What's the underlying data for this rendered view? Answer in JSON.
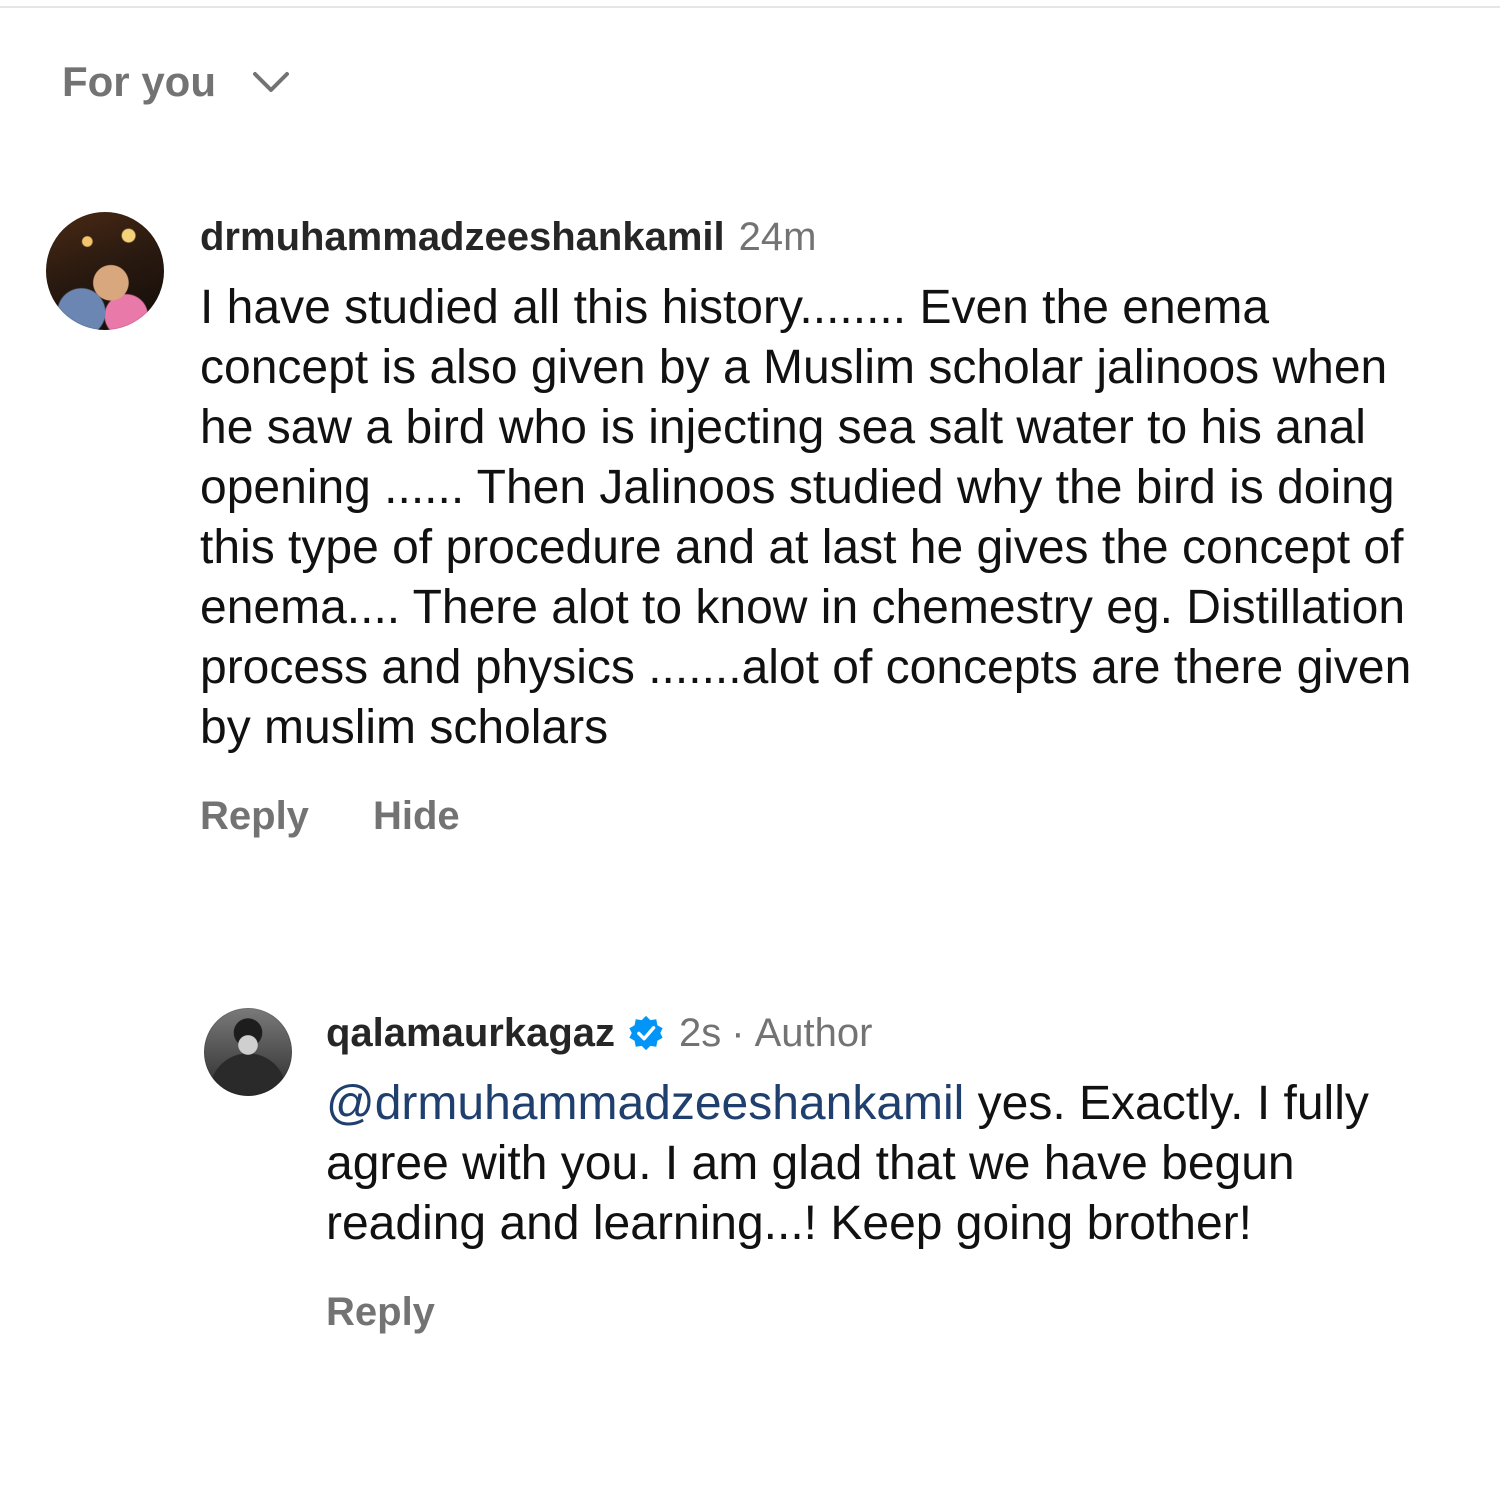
{
  "header": {
    "sort_label": "For you",
    "sort_icon": "chevron-down-icon"
  },
  "comments": [
    {
      "username": "drmuhammadzeeshankamil",
      "timestamp": "24m",
      "text": "I have studied all this history........ Even the enema concept is also given by a Muslim scholar jalinoos when he saw a bird who is injecting sea salt water to his anal opening ...... Then Jalinoos studied why the bird is doing this type of procedure and at last he gives the concept of enema.... There alot to know in chemestry eg. Distillation process and physics .......alot of concepts are there given by muslim scholars",
      "actions": {
        "reply": "Reply",
        "hide": "Hide"
      }
    }
  ],
  "reply": {
    "username": "qalamaurkagaz",
    "verified_icon": "verified-badge-icon",
    "verified_color": "#0095f6",
    "timestamp": "2s",
    "separator": "·",
    "author_tag": "Author",
    "mention": "@drmuhammadzeeshankamil",
    "text": " yes. Exactly. I fully agree with you. I am glad that we have begun reading and learning...! Keep going brother!",
    "actions": {
      "reply": "Reply"
    }
  },
  "colors": {
    "secondary_text": "#737373",
    "mention": "#1f3f6e",
    "primary_text": "#111111"
  }
}
